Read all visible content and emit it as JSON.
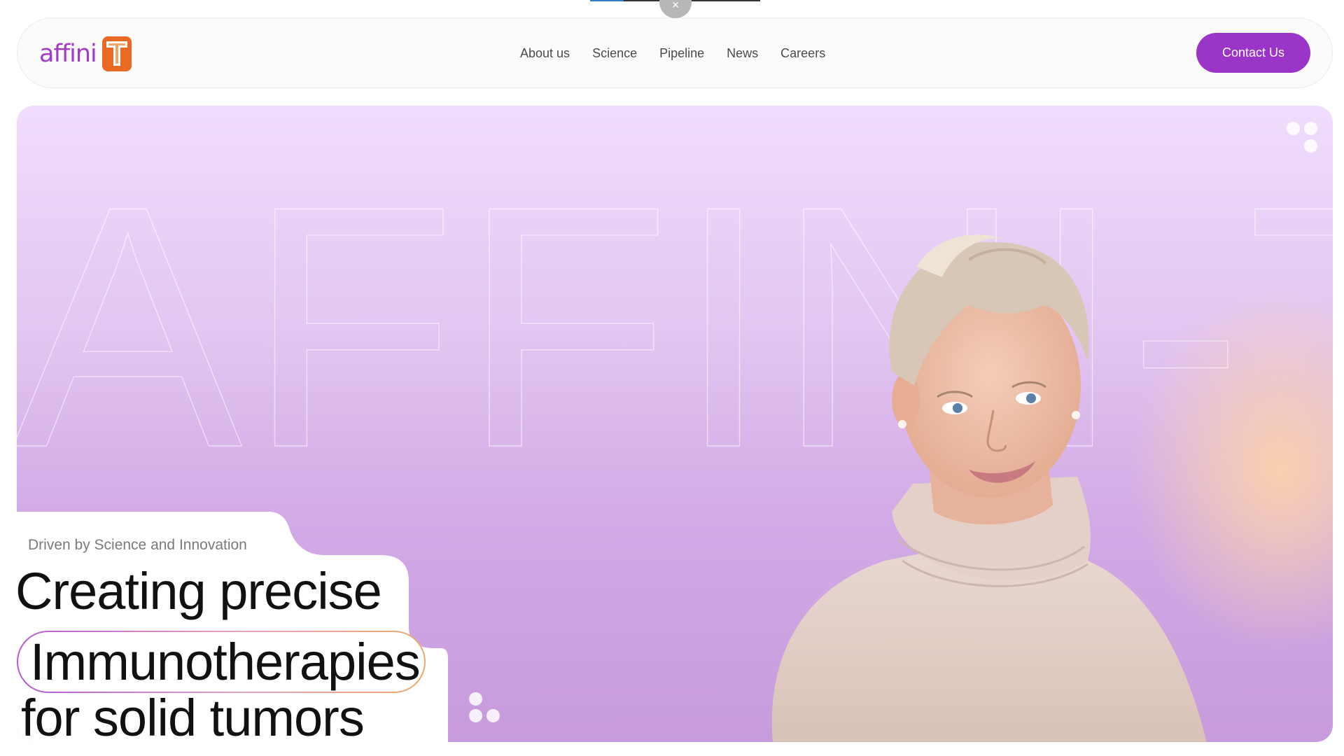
{
  "top_overlay": {
    "close_icon": "close-icon",
    "close_glyph": "×"
  },
  "brand": {
    "logo_text": "affini",
    "logo_icon": "affini-t-mark-icon",
    "colors": {
      "purple": "#9b35c8",
      "orange": "#e96a24"
    }
  },
  "nav": {
    "items": [
      {
        "label": "About us"
      },
      {
        "label": "Science"
      },
      {
        "label": "Pipeline"
      },
      {
        "label": "News"
      },
      {
        "label": "Careers"
      }
    ],
    "cta_label": "Contact Us"
  },
  "hero": {
    "watermark_text": "AFFINI-T",
    "tagline": "Driven by Science and Innovation",
    "headline": {
      "line1": "Creating precise",
      "highlight": "Immunotherapies",
      "line3": "for solid tumors"
    },
    "image_alt": "smiling-woman-photo",
    "decor_icons": [
      "dots-cluster-icon",
      "dots-cluster-icon"
    ]
  }
}
